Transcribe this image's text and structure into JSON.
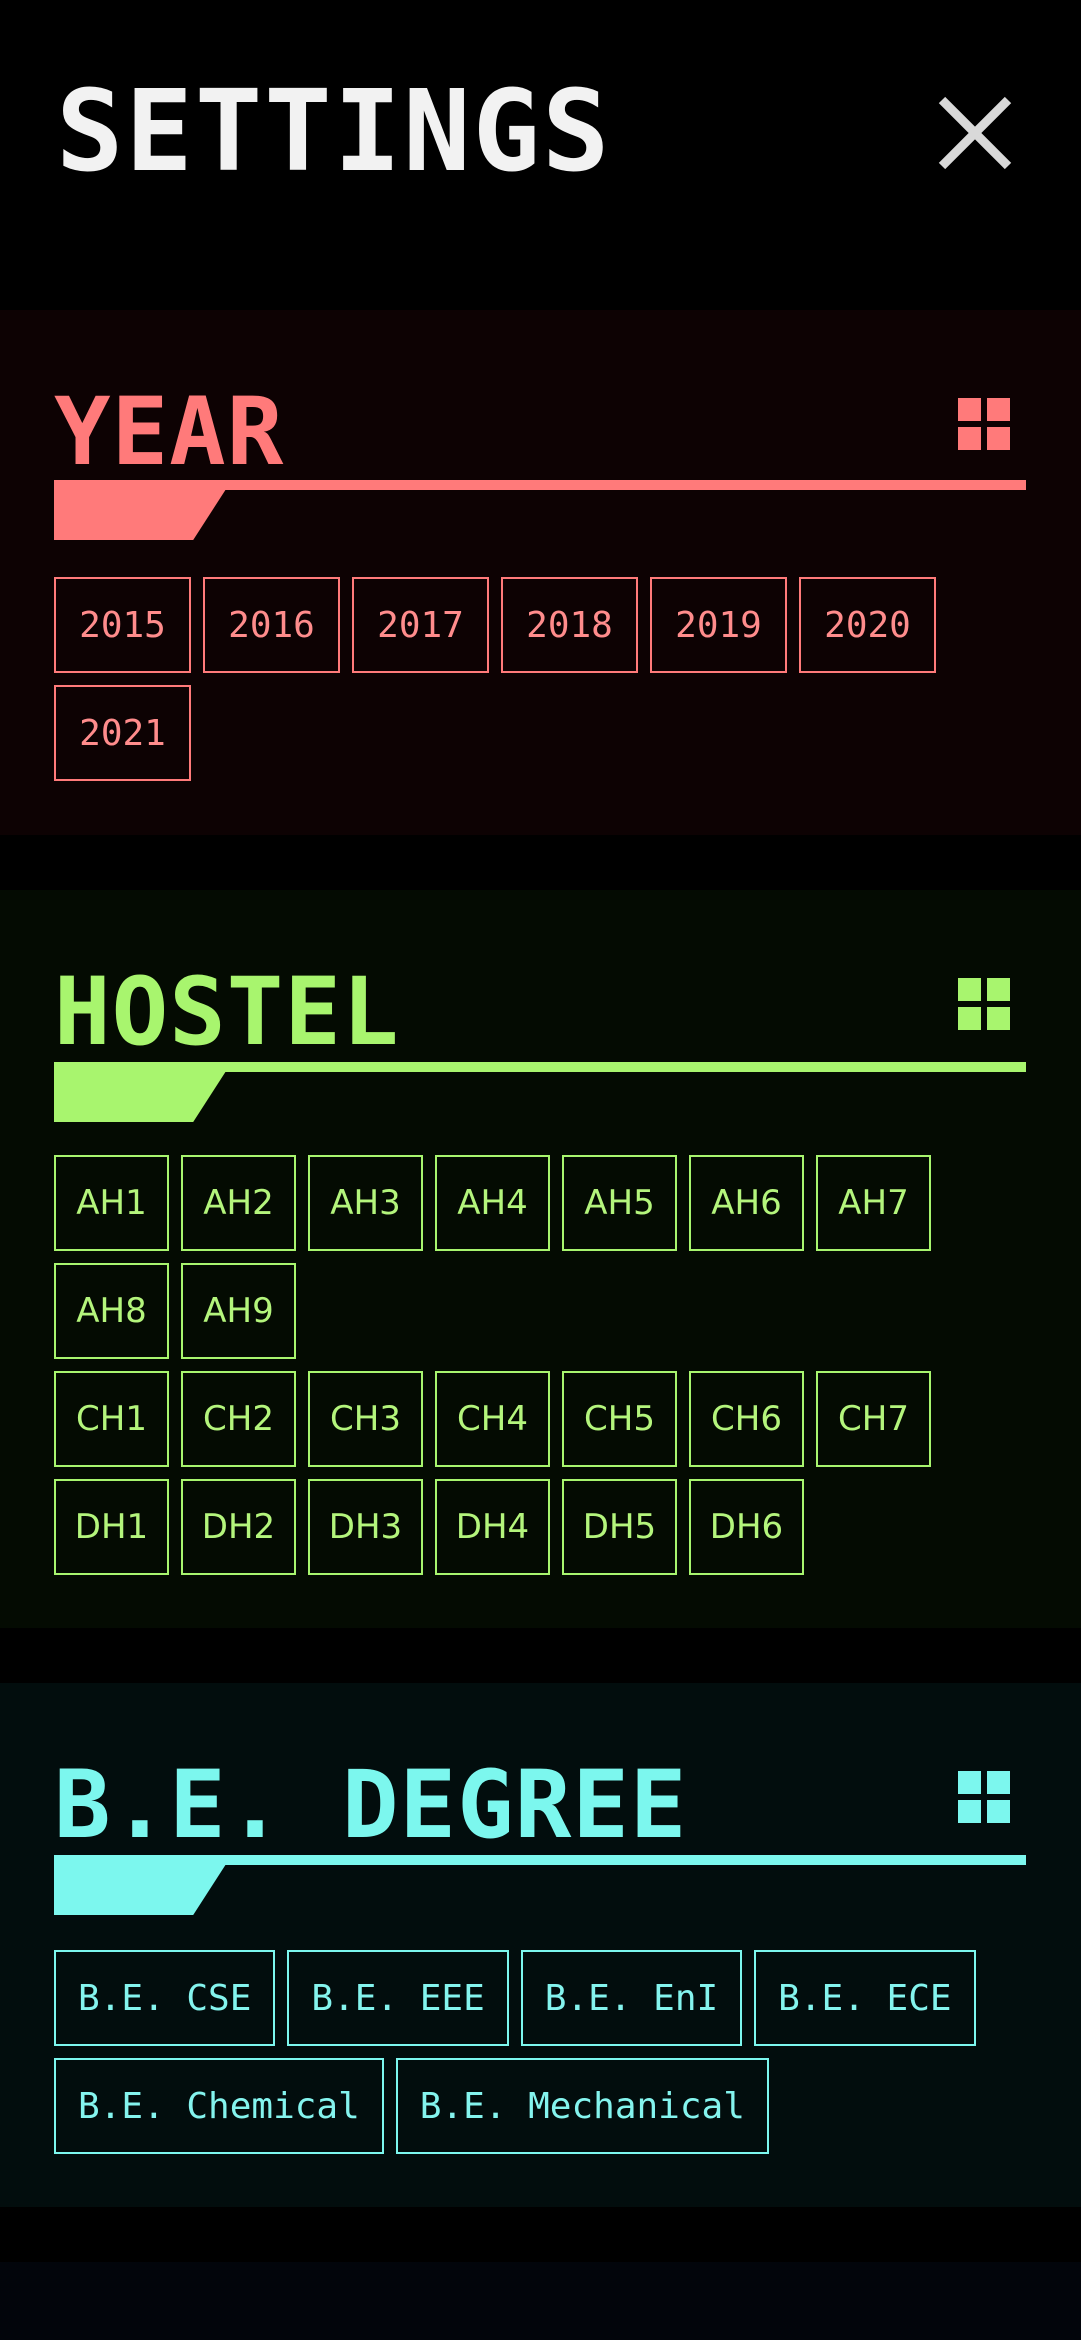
{
  "header": {
    "title": "SETTINGS",
    "close_icon": "close-icon"
  },
  "colors": {
    "background": "#000000",
    "title": "#f2f2f2",
    "year_accent": "#ff7a7a",
    "hostel_accent": "#a8f56e",
    "degree_accent": "#7cf7ee"
  },
  "sections": {
    "year": {
      "title": "YEAR",
      "icon": "grid-icon",
      "rows": [
        [
          "2015",
          "2016",
          "2017",
          "2018",
          "2019",
          "2020"
        ],
        [
          "2021"
        ]
      ]
    },
    "hostel": {
      "title": "HOSTEL",
      "icon": "grid-icon",
      "rows": [
        [
          "AH1",
          "AH2",
          "AH3",
          "AH4",
          "AH5",
          "AH6",
          "AH7"
        ],
        [
          "AH8",
          "AH9"
        ],
        [
          "CH1",
          "CH2",
          "CH3",
          "CH4",
          "CH5",
          "CH6",
          "CH7"
        ],
        [
          "DH1",
          "DH2",
          "DH3",
          "DH4",
          "DH5",
          "DH6"
        ]
      ]
    },
    "degree": {
      "title": "B.E. DEGREE",
      "icon": "grid-icon",
      "rows": [
        [
          "B.E. CSE",
          "B.E. EEE",
          "B.E. EnI",
          "B.E. ECE"
        ],
        [
          "B.E. Chemical",
          "B.E. Mechanical"
        ]
      ]
    }
  }
}
